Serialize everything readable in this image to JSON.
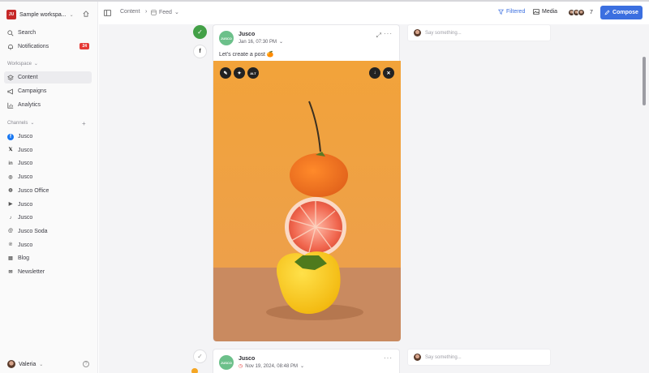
{
  "sidebar": {
    "workspace": "Sample workspa...",
    "search": "Search",
    "notifications": "Notifications",
    "notification_count": "24",
    "workspace_section": "Workspace",
    "nav": [
      "Content",
      "Campaigns",
      "Analytics"
    ],
    "channels_section": "Channels",
    "channels": [
      {
        "label": "Jusco",
        "icon": "facebook-icon",
        "color": "#1877f2"
      },
      {
        "label": "Jusco",
        "icon": "x-icon",
        "color": "#222222"
      },
      {
        "label": "Jusco",
        "icon": "linkedin-icon",
        "color": "#555555"
      },
      {
        "label": "Jusco",
        "icon": "instagram-icon",
        "color": "#555555"
      },
      {
        "label": "Jusco Office",
        "icon": "google-business-icon",
        "color": "#555555"
      },
      {
        "label": "Jusco",
        "icon": "youtube-icon",
        "color": "#555555"
      },
      {
        "label": "Jusco",
        "icon": "tiktok-icon",
        "color": "#555555"
      },
      {
        "label": "Jusco Soda",
        "icon": "threads-icon",
        "color": "#555555"
      },
      {
        "label": "Jusco",
        "icon": "pinterest-icon",
        "color": "#555555"
      },
      {
        "label": "Blog",
        "icon": "blog-icon",
        "color": "#555555"
      },
      {
        "label": "Newsletter",
        "icon": "mail-icon",
        "color": "#555555"
      }
    ],
    "user": "Valeria"
  },
  "header": {
    "breadcrumb_1": "Content",
    "breadcrumb_2": "Feed",
    "filter": "Filtered",
    "media": "Media",
    "member_count": "7",
    "compose": "Compose"
  },
  "posts": [
    {
      "author": "Jusco",
      "avatar_text": "JUSCO",
      "date": "Jan 16, 07:30 PM",
      "text": "Let's create a post 🍊",
      "image_buttons_left": [
        "pen-icon",
        "magic-icon",
        "ALT"
      ],
      "comment_placeholder": "Say something..."
    },
    {
      "author": "Jusco",
      "avatar_text": "JUSCO",
      "date": "Nov 19, 2024, 08:48 PM",
      "comment_placeholder": "Say something..."
    }
  ],
  "colors": {
    "accent": "#3b6fe0",
    "status_green": "#43a047",
    "badge_red": "#e53935",
    "orange_bg": "#f0a33a"
  }
}
